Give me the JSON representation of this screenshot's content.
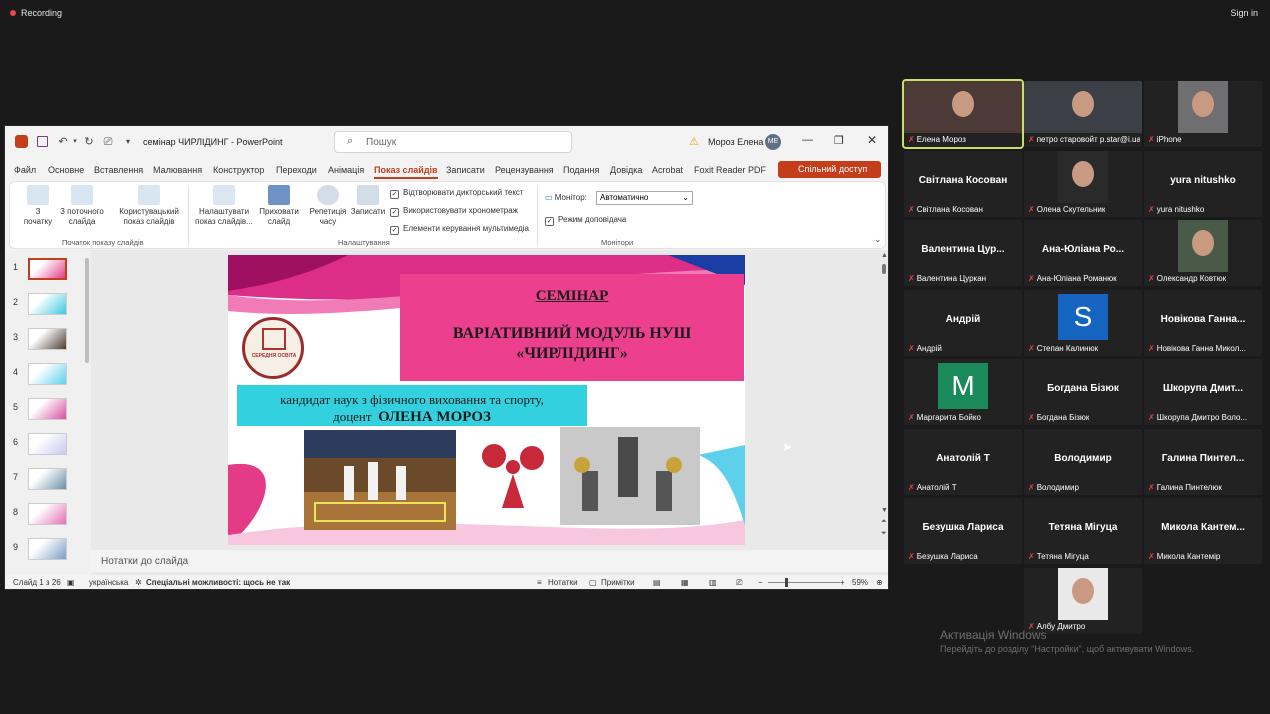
{
  "topbar": {
    "recording": "Recording",
    "signin": "Sign in"
  },
  "ppt": {
    "title": "семінар ЧИРЛІДИНГ  -  PowerPoint",
    "search_placeholder": "Пошук",
    "user_name": "Мороз Елена",
    "user_initials": "МЕ",
    "menu": [
      "Файл",
      "Основне",
      "Вставлення",
      "Малювання",
      "Конструктор",
      "Переходи",
      "Анімація",
      "Показ слайдів",
      "Записати",
      "Рецензування",
      "Подання",
      "Довідка",
      "Acrobat",
      "Foxit Reader PDF"
    ],
    "share": "Спільний доступ",
    "ribbon": {
      "btn_from_start": "З\nпочатку",
      "btn_from_current": "З поточного\nслайда",
      "btn_custom": "Користувацький\nпоказ слайдів",
      "group_start": "Початок показу слайдів",
      "btn_setup": "Налаштувати\nпоказ слайдів...",
      "btn_hide": "Приховати\nслайд",
      "btn_rehearse": "Репетиція\nчасу",
      "btn_record": "Записати",
      "group_setup": "Налаштування",
      "chk_narration": "Відтворювати дикторський текст",
      "chk_timings": "Використовувати хронометраж",
      "chk_media": "Елементи керування мультимедіа",
      "monitor_label": "Монітор:",
      "monitor_value": "Автоматично",
      "chk_presenter": "Режим доповідача",
      "group_monitors": "Монітори"
    },
    "thumbs": [
      "1",
      "2",
      "3",
      "4",
      "5",
      "6",
      "7",
      "8",
      "9"
    ],
    "slide": {
      "heading": "СЕМІНАР",
      "module_line1": "ВАРІАТИВНИЙ МОДУЛЬ НУШ",
      "module_line2": "«ЧИРЛІДИНГ»",
      "author_line1": "кандидат наук з фізичного виховання та спорту,",
      "author_prefix": "доцент",
      "author_name": "ОЛЕНА МОРОЗ",
      "logo_text": "СЕРЕДНЯ ОСВІТА"
    },
    "notes": "Нотатки до слайда",
    "status": {
      "slide": "Слайд 1 з 26",
      "lang": "українська",
      "access": "Спеціальні можливості: щось не так",
      "notes": "Нотатки",
      "comments": "Примітки",
      "zoom": "59%"
    },
    "colors": {
      "accent": "#c43e1c",
      "title_box": "#ec3f8d",
      "author_box": "#33d1e0"
    }
  },
  "gallery": [
    {
      "name": "",
      "label": "Елена Мороз",
      "kind": "photo",
      "active": true
    },
    {
      "name": "",
      "label": "петро старовойт p.star@i.ua",
      "kind": "photo"
    },
    {
      "name": "",
      "label": "iPhone",
      "kind": "photo"
    },
    {
      "name": "Світлана Косован",
      "label": "Світлана Косован",
      "kind": "name"
    },
    {
      "name": "",
      "label": "Олена Скутельник",
      "kind": "photo"
    },
    {
      "name": "yura nitushko",
      "label": "yura nitushko",
      "kind": "name"
    },
    {
      "name": "Валентина Цур...",
      "label": "Валентина Цуркан",
      "kind": "name"
    },
    {
      "name": "Ана-Юліана Ро...",
      "label": "Ана-Юліана Романюк",
      "kind": "name"
    },
    {
      "name": "",
      "label": "Олександр Ковтюк",
      "kind": "photo"
    },
    {
      "name": "Андрій",
      "label": "Андрій",
      "kind": "name"
    },
    {
      "name": "S",
      "label": "Степан Калинюк",
      "kind": "avatar",
      "color": "#1565c0"
    },
    {
      "name": "Новікова Ганна...",
      "label": "Новікова Ганна Микол...",
      "kind": "name"
    },
    {
      "name": "M",
      "label": "Маргарита Бойко",
      "kind": "avatar",
      "color": "#1b8a5a"
    },
    {
      "name": "Богдана Бізюк",
      "label": "Богдана Бізюк",
      "kind": "name"
    },
    {
      "name": "Шкорупа Дмит...",
      "label": "Шкорупа Дмитро Воло...",
      "kind": "name"
    },
    {
      "name": "Анатолій Т",
      "label": "Анатолій Т",
      "kind": "name"
    },
    {
      "name": "Володимир",
      "label": "Володимир",
      "kind": "name"
    },
    {
      "name": "Галина Пинтел...",
      "label": "Галина Пинтелюк",
      "kind": "name"
    },
    {
      "name": "Безушка Лариса",
      "label": "Безушка Лариса",
      "kind": "name"
    },
    {
      "name": "Тетяна Мігуца",
      "label": "Тетяна Мігуца",
      "kind": "name"
    },
    {
      "name": "Микола Кантем...",
      "label": "Микола Кантемір",
      "kind": "name"
    },
    {
      "name": "",
      "label": "Албу Дмитро",
      "kind": "photo"
    }
  ],
  "watermark": {
    "title": "Активація Windows",
    "sub": "Перейдіть до розділу \"Настройки\", щоб активувати Windows."
  }
}
